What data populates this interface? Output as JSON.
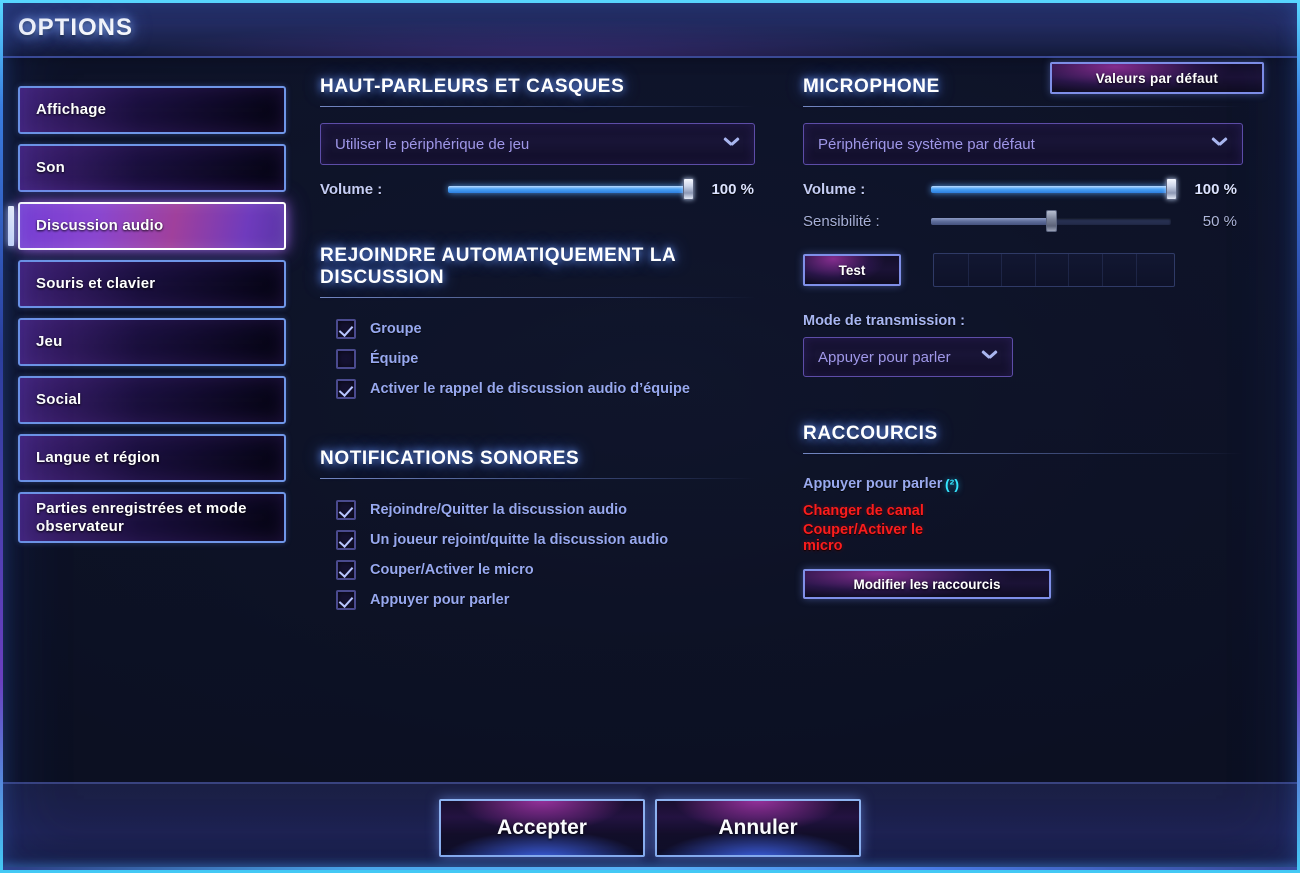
{
  "window": {
    "title": "OPTIONS"
  },
  "sidebar": {
    "items": [
      {
        "label": "Affichage",
        "selected": false
      },
      {
        "label": "Son",
        "selected": false
      },
      {
        "label": "Discussion audio",
        "selected": true
      },
      {
        "label": "Souris et clavier",
        "selected": false
      },
      {
        "label": "Jeu",
        "selected": false
      },
      {
        "label": "Social",
        "selected": false
      },
      {
        "label": "Langue et région",
        "selected": false
      },
      {
        "label": "Parties enregistrées et mode observateur",
        "selected": false
      }
    ]
  },
  "toolbar": {
    "defaults_label": "Valeurs par défaut"
  },
  "speakers": {
    "heading": "HAUT-PARLEURS ET CASQUES",
    "device_value": "Utiliser le périphérique de jeu",
    "volume_label": "Volume :",
    "volume_value": "100 %",
    "volume_percent": 100
  },
  "autojoin": {
    "heading": "REJOINDRE AUTOMATIQUEMENT LA DISCUSSION",
    "options": [
      {
        "label": "Groupe",
        "checked": true
      },
      {
        "label": "Équipe",
        "checked": false
      },
      {
        "label": "Activer le rappel de discussion audio d’équipe",
        "checked": true
      }
    ]
  },
  "sound_notifications": {
    "heading": "NOTIFICATIONS SONORES",
    "options": [
      {
        "label": "Rejoindre/Quitter la discussion audio",
        "checked": true
      },
      {
        "label": "Un joueur rejoint/quitte la discussion audio",
        "checked": true
      },
      {
        "label": "Couper/Activer le micro",
        "checked": true
      },
      {
        "label": "Appuyer pour parler",
        "checked": true
      }
    ]
  },
  "microphone": {
    "heading": "MICROPHONE",
    "device_value": "Périphérique système par défaut",
    "volume_label": "Volume :",
    "volume_value": "100 %",
    "volume_percent": 100,
    "sensitivity_label": "Sensibilité :",
    "sensitivity_value": "50 %",
    "sensitivity_percent": 50,
    "test_label": "Test",
    "transmission_label": "Mode de transmission :",
    "transmission_value": "Appuyer pour parler"
  },
  "shortcuts": {
    "heading": "RACCOURCIS",
    "rows": [
      {
        "name": "Appuyer pour parler",
        "key": "(²)",
        "conflict": false
      },
      {
        "name": "Changer de canal",
        "key": "",
        "conflict": true
      },
      {
        "name": "Couper/Activer le micro",
        "key": "",
        "conflict": true
      }
    ],
    "edit_label": "Modifier les raccourcis"
  },
  "footer": {
    "accept_label": "Accepter",
    "cancel_label": "Annuler"
  },
  "colors": {
    "accent_blue": "#4aa2f5",
    "accent_purple": "#8a46cf",
    "conflict_red": "#fa1d1d",
    "key_cyan": "#35e6ff"
  }
}
